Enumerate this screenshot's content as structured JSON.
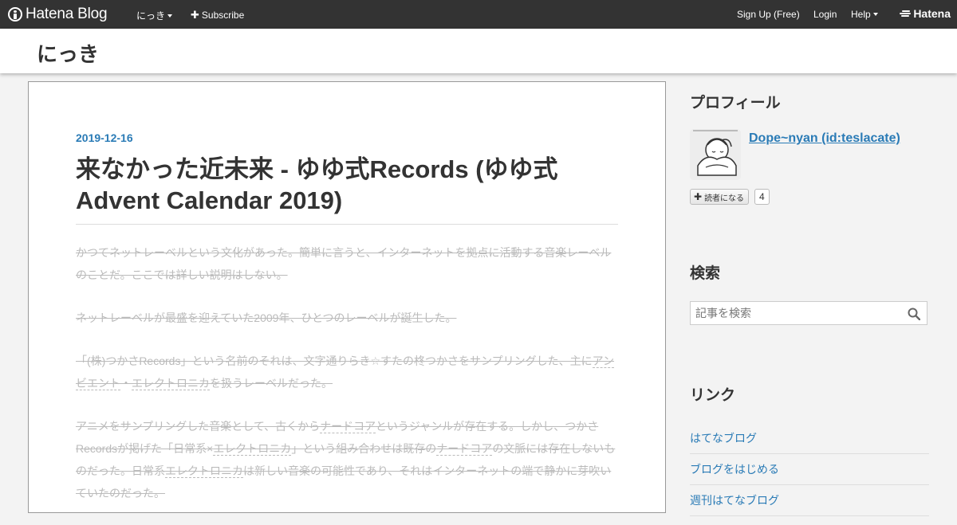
{
  "global_header": {
    "logo_text": "Hatena Blog",
    "blog_menu_label": "にっき",
    "subscribe_label": "Subscribe",
    "signup_label": "Sign Up (Free)",
    "login_label": "Login",
    "help_label": "Help",
    "brand_text": "Hatena"
  },
  "blog": {
    "title": "にっき"
  },
  "entry": {
    "date": "2019-12-16",
    "title": "来なかった近未来 - ゆゆ式Records (ゆゆ式 Advent Calendar 2019)",
    "paragraphs": {
      "p1": "かつてネットレーベルという文化があった。簡単に言うと、インターネットを拠点に活動する音楽レーベルのことだ。ここでは詳しい説明はしない。",
      "p2": "ネットレーベルが最盛を迎えていた2009年、ひとつのレーベルが誕生した。",
      "p3_a": "「(株)つかさRecords」という名前のそれは、文字通りらき☆すたの柊つかさをサンプリングした、主に",
      "p3_link1": "アンビエント",
      "p3_b": "・",
      "p3_link2": "エレクトロニカ",
      "p3_c": "を扱うレーベルだった。",
      "p4_a": "アニメをサンプリングした音楽として、古くから",
      "p4_link1": "ナードコア",
      "p4_b": "というジャンルが存在する。しかし、つかさRecordsが掲げた「日常系×",
      "p4_link2": "エレクトロニカ",
      "p4_c": "」という組み合わせは既存の",
      "p4_link3": "ナードコア",
      "p4_d": "の文脈には存在しないものだった。日常系",
      "p4_link4": "エレクトロニカ",
      "p4_e": "は新しい音楽の可能性であり、それはインターネットの端で静かに芽吹いていたのだった。"
    }
  },
  "sidebar": {
    "profile": {
      "heading": "プロフィール",
      "name": "Dope~nyan (id:teslacate)",
      "subscribe_label": "読者になる",
      "subscriber_count": "4"
    },
    "search": {
      "heading": "検索",
      "placeholder": "記事を検索"
    },
    "links": {
      "heading": "リンク",
      "items": [
        "はてなブログ",
        "ブログをはじめる",
        "週刊はてなブログ"
      ]
    }
  },
  "colors": {
    "accent": "#2a7bb6",
    "topbar": "#333333",
    "strike_text": "#bbbbbb"
  }
}
